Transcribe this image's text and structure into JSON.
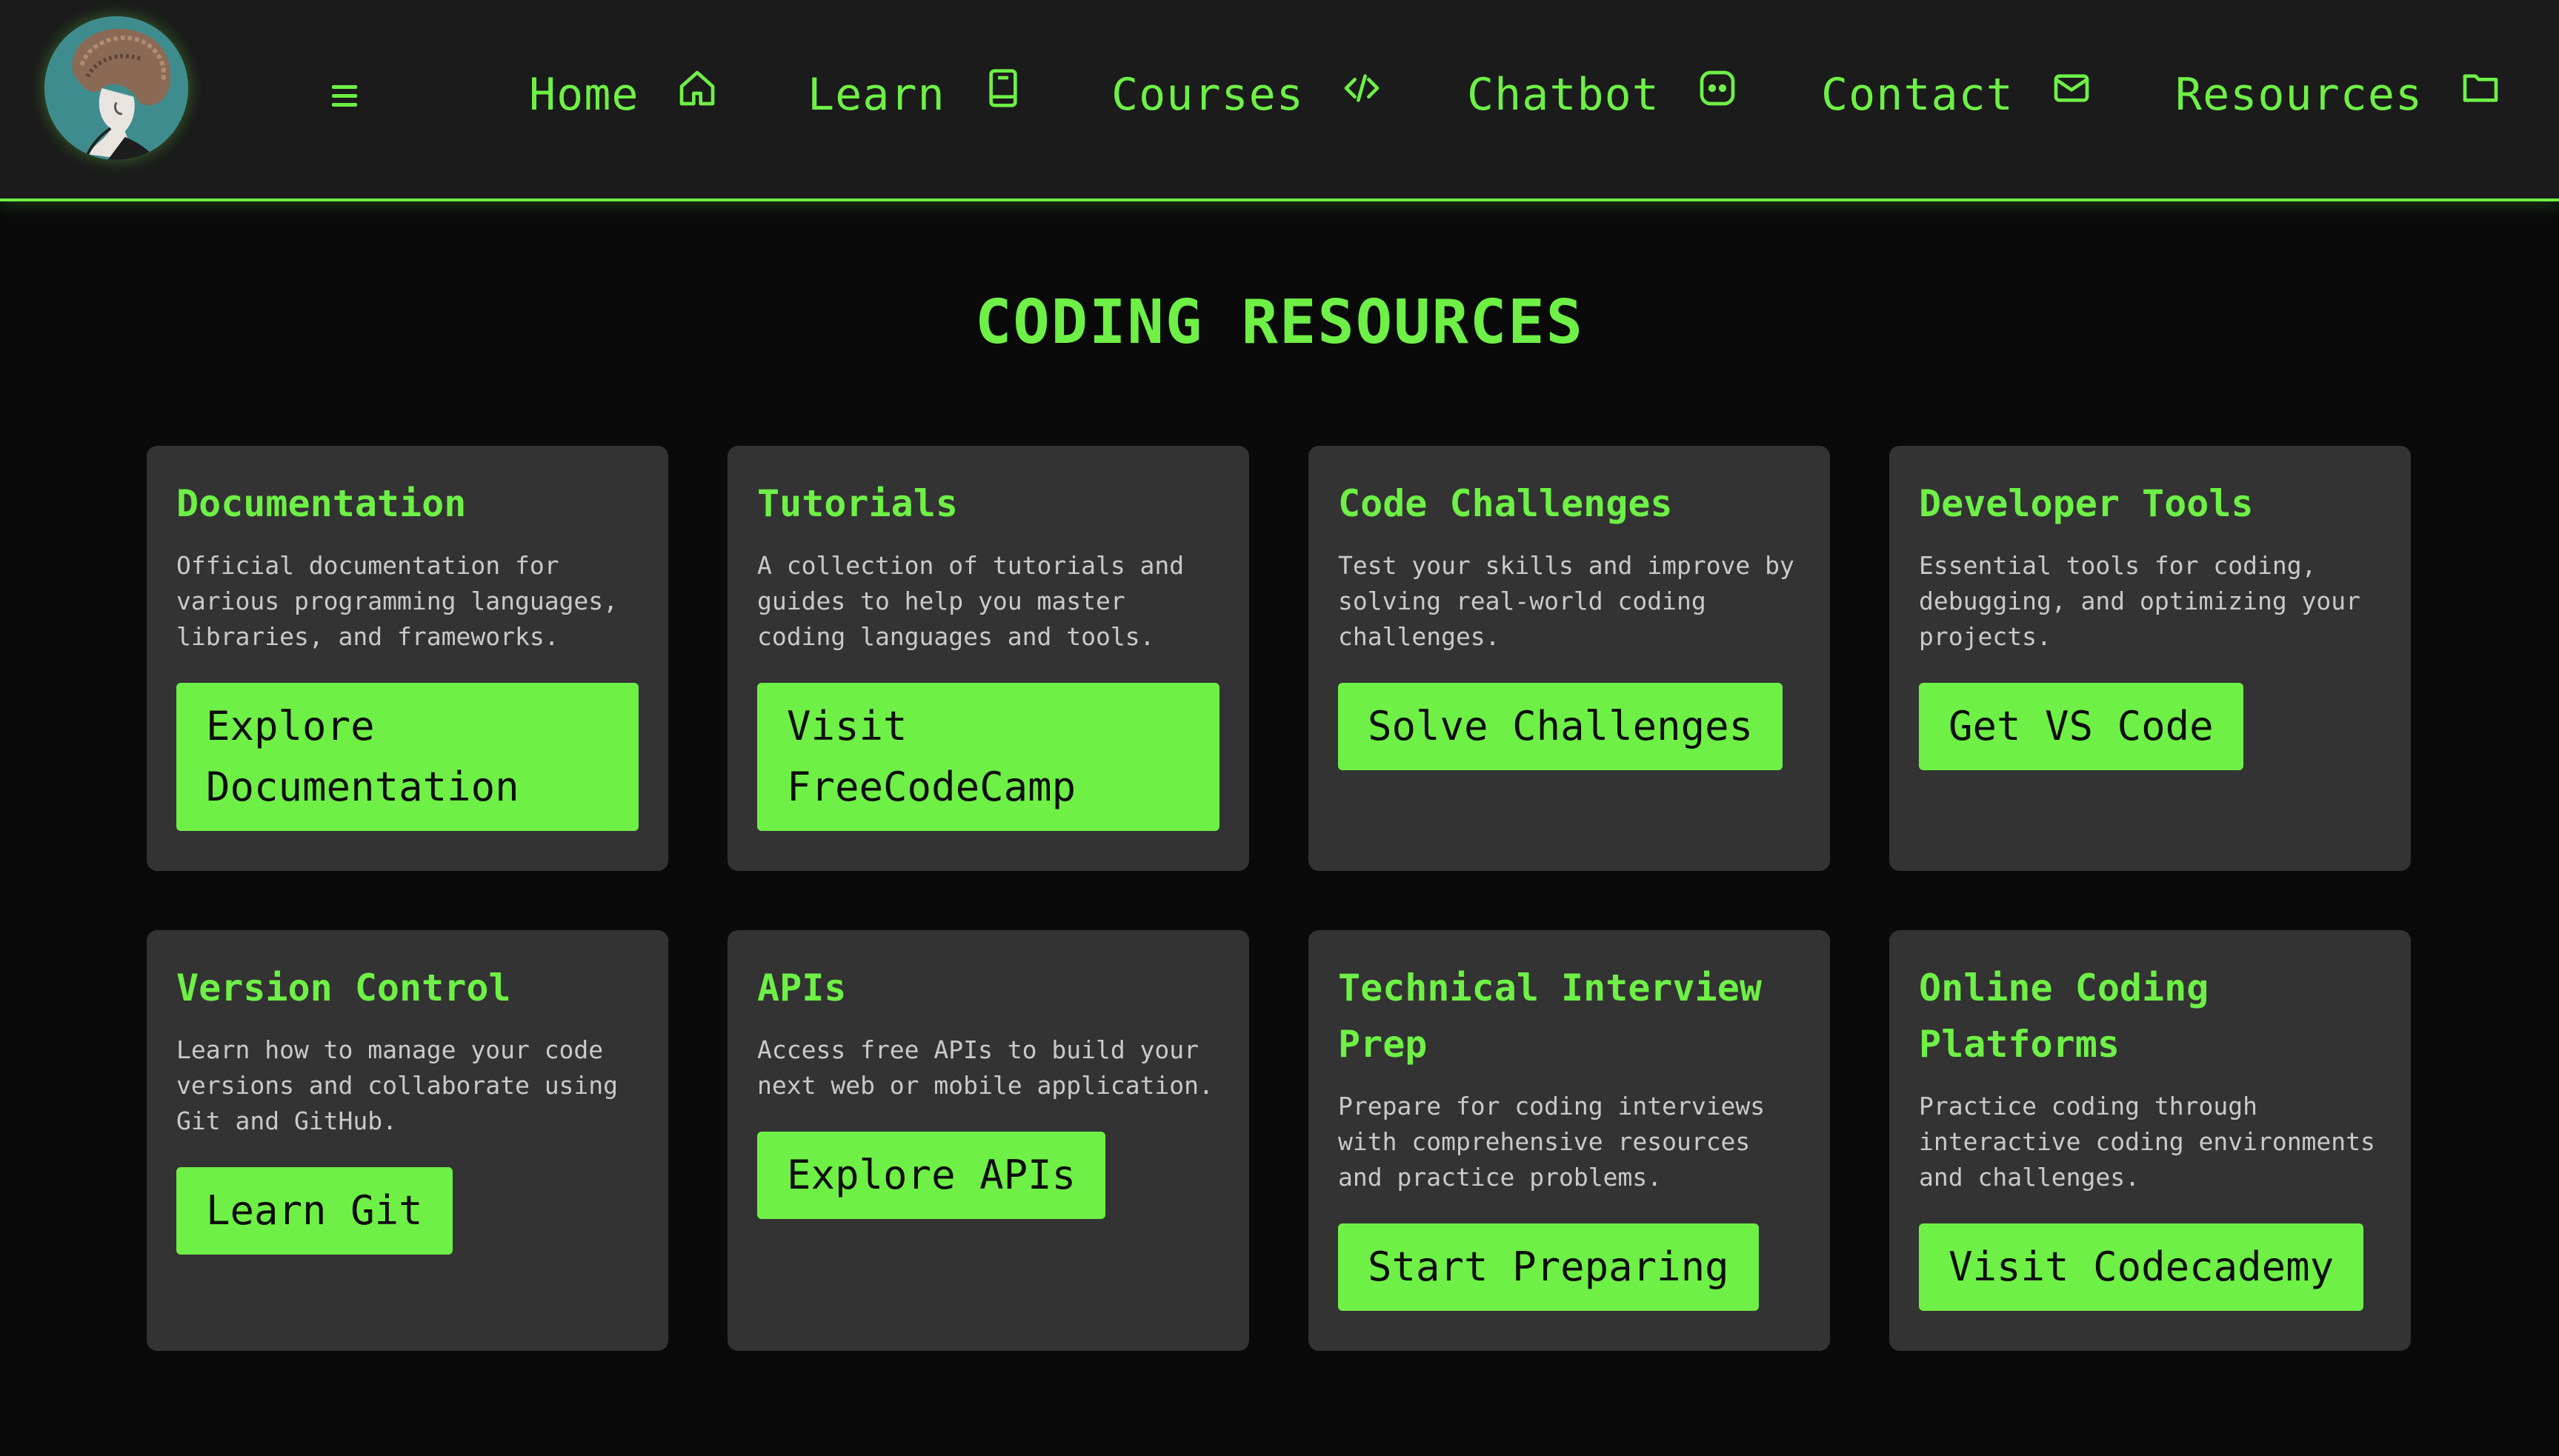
{
  "header": {
    "menu_icon": "hamburger-icon",
    "nav": [
      {
        "label": "Home",
        "icon": "home-icon"
      },
      {
        "label": "Learn",
        "icon": "book-icon"
      },
      {
        "label": "Courses",
        "icon": "code-icon"
      },
      {
        "label": "Chatbot",
        "icon": "chatbot-icon"
      },
      {
        "label": "Contact",
        "icon": "mail-icon"
      },
      {
        "label": "Resources",
        "icon": "folder-icon"
      }
    ]
  },
  "main": {
    "title": "CODING RESOURCES",
    "cards": [
      {
        "title": "Documentation",
        "description": "Official documentation for various programming languages, libraries, and frameworks.",
        "button": "Explore Documentation"
      },
      {
        "title": "Tutorials",
        "description": "A collection of tutorials and guides to help you master coding languages and tools.",
        "button": "Visit FreeCodeCamp"
      },
      {
        "title": "Code Challenges",
        "description": "Test your skills and improve by solving real-world coding challenges.",
        "button": "Solve Challenges"
      },
      {
        "title": "Developer Tools",
        "description": "Essential tools for coding, debugging, and optimizing your projects.",
        "button": "Get VS Code"
      },
      {
        "title": "Version Control",
        "description": "Learn how to manage your code versions and collaborate using Git and GitHub.",
        "button": "Learn Git"
      },
      {
        "title": "APIs",
        "description": "Access free APIs to build your next web or mobile application.",
        "button": "Explore APIs"
      },
      {
        "title": "Technical Interview Prep",
        "description": "Prepare for coding interviews with comprehensive resources and practice problems.",
        "button": "Start Preparing"
      },
      {
        "title": "Online Coding Platforms",
        "description": "Practice coding through interactive coding environments and challenges.",
        "button": "Visit Codecademy"
      }
    ]
  },
  "colors": {
    "accent": "#6ef046",
    "header_bg": "#1b1b1b",
    "page_bg": "#0a0a0a",
    "card_bg": "#333333",
    "description_text": "#c9c9c9"
  }
}
